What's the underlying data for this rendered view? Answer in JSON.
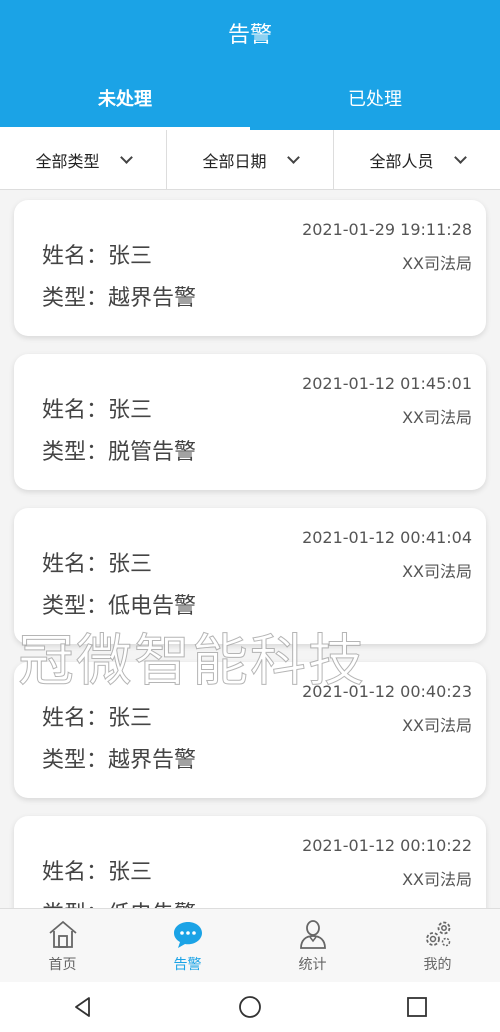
{
  "header": {
    "title": "告警"
  },
  "tabs": [
    {
      "label": "未处理",
      "active": true
    },
    {
      "label": "已处理",
      "active": false
    }
  ],
  "filters": [
    {
      "label": "全部类型"
    },
    {
      "label": "全部日期"
    },
    {
      "label": "全部人员"
    }
  ],
  "alerts": [
    {
      "time": "2021-01-29 19:11:28",
      "org": "XX司法局",
      "name": "姓名：张三",
      "type": "类型：越界告警"
    },
    {
      "time": "2021-01-12 01:45:01",
      "org": "XX司法局",
      "name": "姓名：张三",
      "type": "类型：脱管告警"
    },
    {
      "time": "2021-01-12 00:41:04",
      "org": "XX司法局",
      "name": "姓名：张三",
      "type": "类型：低电告警"
    },
    {
      "time": "2021-01-12 00:40:23",
      "org": "XX司法局",
      "name": "姓名：张三",
      "type": "类型：越界告警"
    },
    {
      "time": "2021-01-12 00:10:22",
      "org": "XX司法局",
      "name": "姓名：张三",
      "type": "类型：低电告警"
    }
  ],
  "watermark": "冠微智能科技",
  "tabbar": [
    {
      "label": "首页",
      "icon": "home-icon",
      "active": false
    },
    {
      "label": "告警",
      "icon": "chat-bubble-icon",
      "active": true
    },
    {
      "label": "统计",
      "icon": "person-icon",
      "active": false
    },
    {
      "label": "我的",
      "icon": "gears-icon",
      "active": false
    }
  ],
  "colors": {
    "accent": "#1ba3e6"
  }
}
